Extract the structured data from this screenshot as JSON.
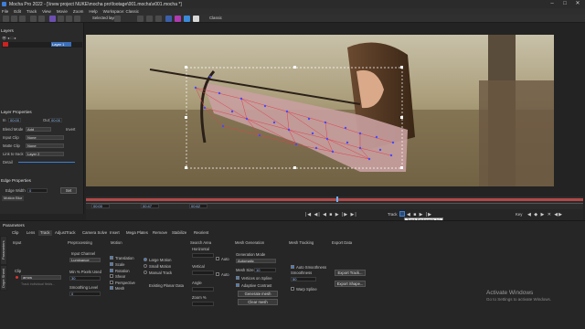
{
  "app": {
    "title": "Mocha Pro 2022 - [\\\\new project NUKE\\mocha pro\\footage\\001.mocha\\v001.mocha *]"
  },
  "menu": [
    "File",
    "Edit",
    "Track",
    "View",
    "Movie",
    "Zoom",
    "Help",
    "Workspace: Classic"
  ],
  "toolbar": {
    "layer_label": "Selected layer",
    "workspace": "Classic"
  },
  "layers": {
    "title": "Layers",
    "items": [
      {
        "name": "Layer 1"
      }
    ]
  },
  "layer_props": {
    "title": "Layer Properties",
    "in_label": "In",
    "in_val": "00:00",
    "out_label": "Out",
    "out_val": "00:00",
    "blend_label": "Blend Mode",
    "blend_val": "Add",
    "invert_label": "Invert",
    "input_clip_label": "Input Clip",
    "input_clip_val": "None",
    "matte_clip_label": "Matte Clip",
    "matte_clip_val": "None",
    "link_label": "Link to track",
    "link_val": "Layer 2",
    "detail_label": "Detail"
  },
  "edge_props": {
    "title": "Edge Properties",
    "edge_width_label": "Edge Width",
    "edge_width_val": "0",
    "set_label": "Set",
    "motion_blur_label": "Motion Blur"
  },
  "timeline": {
    "in_tc": "00:00",
    "cur_tc": "00:47",
    "out_tc": "00:62"
  },
  "transport": {
    "track_label": "Track",
    "tooltip": "Track Backwards (<)",
    "key_label": "Key"
  },
  "params": {
    "title": "Parameters",
    "tabs": [
      "Clip",
      "Lens",
      "Track",
      "AdjustTrack",
      "Camera Solve",
      "Insert",
      "Mega Plates",
      "Remove",
      "Stabilize",
      "Reorient"
    ],
    "side_tabs": [
      "Parameters",
      "Dope Sheet"
    ],
    "input": {
      "title": "Input",
      "clip_label": "Clip",
      "clip_val": "arrow",
      "hint": "Track individual fields..."
    },
    "pre": {
      "title": "Preprocessing",
      "channel_label": "Input Channel",
      "channel_val": "Luminance",
      "min_pixels_label": "Min % Pixels Used",
      "min_pixels_val": "30",
      "smoothing_label": "Smoothing Level",
      "smoothing_val": "0"
    },
    "motion": {
      "title": "Motion",
      "items": [
        "Translation",
        "Scale",
        "Rotation",
        "Shear",
        "Perspective",
        "Mesh"
      ],
      "large": "Large Motion",
      "small": "Small Motion",
      "manual": "Manual Track",
      "planar": "Existing Planar Data"
    },
    "search": {
      "title": "Search Area",
      "horizontal": "Horizontal",
      "vertical": "Vertical",
      "angle": "Angle",
      "zoom": "Zoom %",
      "auto": "Auto"
    },
    "mesh": {
      "title": "Mesh Generation",
      "mode_label": "Generation Mode",
      "mode_val": "Automatic",
      "size_label": "Mesh Size",
      "size_val": "10",
      "vert_spline": "Vertices on Spline",
      "adaptive": "Adaptive Contrast",
      "generate": "Generate mesh",
      "clear": "Clear mesh"
    },
    "mesh_tracking": {
      "title": "Mesh Tracking",
      "auto_smooth": "Auto Smoothness",
      "smooth_label": "Smoothness",
      "smooth_val": "50",
      "warp": "Warp Spline"
    },
    "export": {
      "title": "Export Data",
      "track": "Export Track...",
      "shape": "Export Shape..."
    }
  },
  "windows": {
    "line1": "Activate Windows",
    "line2": "Go to Settings to activate Windows."
  }
}
